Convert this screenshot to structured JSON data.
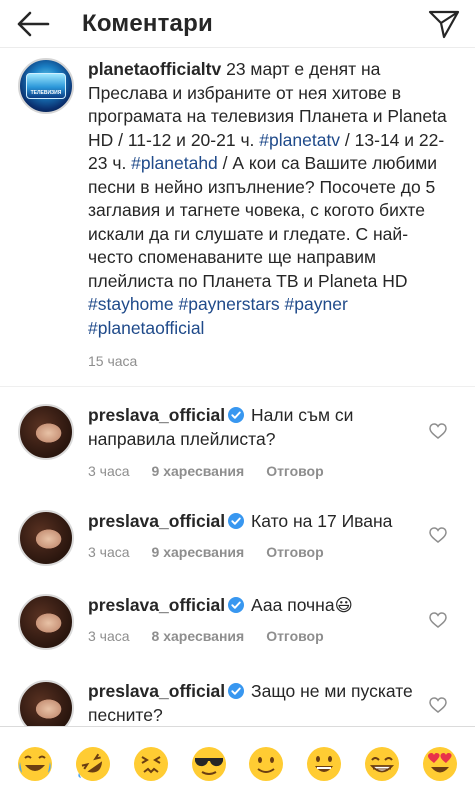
{
  "header": {
    "title": "Коментари"
  },
  "caption": {
    "username": "planetaofficialtv",
    "segments": [
      {
        "text": " 23 март е денят на Преслава и избраните от нея хитове в програмата на телевизия Планета и Planeta HD / 11-12 и 20-21 ч. ",
        "tag": false
      },
      {
        "text": "#planetatv",
        "tag": true
      },
      {
        "text": " / 13-14 и 22-23 ч. ",
        "tag": false
      },
      {
        "text": "#planetahd",
        "tag": true
      },
      {
        "text": " / А кои са Вашите любими песни в нейно изпълнение? Посочете до 5 заглавия и тагнете човека, с когото бихте искали да ги слушате и гледате. С най-често споменаваните ще направим плейлиста по Планета ТВ и Planeta HD ",
        "tag": false
      },
      {
        "text": "#stayhome",
        "tag": true
      },
      {
        "text": " ",
        "tag": false
      },
      {
        "text": "#paynerstars",
        "tag": true
      },
      {
        "text": " ",
        "tag": false
      },
      {
        "text": "#payner",
        "tag": true
      },
      {
        "text": " ",
        "tag": false
      },
      {
        "text": "#planetaofficial",
        "tag": true
      }
    ],
    "time": "15 часа",
    "avatar_label": "ТЕЛЕВИЗИЯ"
  },
  "comments": [
    {
      "username": "preslava_official",
      "text": "Нали съм си направила плейлиста?",
      "time": "3 часа",
      "likes": "9 харесвания",
      "reply": "Отговор"
    },
    {
      "username": "preslava_official",
      "text": "Като на 17 Ивана",
      "time": "3 часа",
      "likes": "9 харесвания",
      "reply": "Отговор"
    },
    {
      "username": "preslava_official",
      "text": "Ааа почна😃",
      "time": "3 часа",
      "likes": "8 харесвания",
      "reply": "Отговор"
    },
    {
      "username": "preslava_official",
      "text": "Защо не ми пускате песните?",
      "time": "",
      "likes": "",
      "reply": ""
    }
  ],
  "emoji_bar": [
    "😂",
    "🤣",
    "😣",
    "😎",
    "🙂",
    "😀",
    "😁",
    "😍"
  ],
  "colors": {
    "hashtag": "#1f4a8a",
    "verified": "#3897f0",
    "meta": "#8e8e8e"
  }
}
